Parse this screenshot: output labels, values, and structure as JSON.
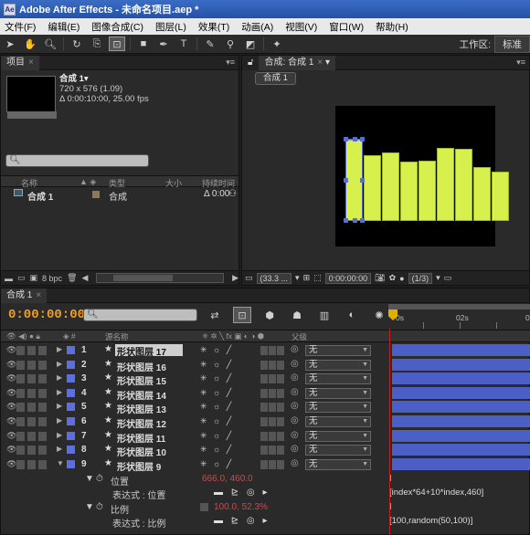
{
  "window": {
    "title": "Adobe After Effects - 未命名项目.aep *",
    "icon": "ae-app-icon"
  },
  "menu": [
    "文件(F)",
    "编辑(E)",
    "图像合成(C)",
    "图层(L)",
    "效果(T)",
    "动画(A)",
    "视图(V)",
    "窗口(W)",
    "帮助(H)"
  ],
  "toolbar": {
    "tools": [
      "selection-icon",
      "hand-icon",
      "zoom-icon",
      "rotate-icon",
      "camera-icon",
      "pan-behind-icon",
      "rectangle-icon",
      "pen-icon",
      "text-icon",
      "brush-icon",
      "clone-stamp-icon",
      "eraser-icon",
      "puppet-pin-icon"
    ],
    "workspace_label": "工作区:",
    "workspace_value": "标准"
  },
  "project": {
    "tab": "项目",
    "comp_name": "合成 1▾",
    "comp_size": "720 x 576 (1.09)",
    "comp_duration": "Δ 0:00:10:00, 25.00 fps",
    "columns": {
      "name": "名称",
      "type": "类型",
      "size": "大小",
      "duration": "持续时间"
    },
    "item": {
      "name": "合成 1",
      "type": "合成",
      "duration": "Δ 0:00"
    },
    "bpc": "8 bpc"
  },
  "viewer": {
    "tab": "合成: 合成 1",
    "subtab": "合成 1",
    "zoom": "(33.3 ...",
    "timecode": "0:00:00:00",
    "resolution": "(1/3)",
    "bar_color": "#d7f04b",
    "bar_heights": [
      0.58,
      0.47,
      0.49,
      0.42,
      0.43,
      0.52,
      0.51,
      0.38,
      0.35
    ]
  },
  "timeline": {
    "tab": "合成 1",
    "timecode": "0:00:00:00",
    "search_placeholder": "",
    "ruler_labels": [
      "0s",
      "02s",
      "0"
    ],
    "col_headers": {
      "source": "源名称",
      "parent": "父级"
    },
    "layers": [
      {
        "num": "1",
        "name": "形状图层 17",
        "parent": "无"
      },
      {
        "num": "2",
        "name": "形状图层 16",
        "parent": "无"
      },
      {
        "num": "3",
        "name": "形状图层 15",
        "parent": "无"
      },
      {
        "num": "4",
        "name": "形状图层 14",
        "parent": "无"
      },
      {
        "num": "5",
        "name": "形状图层 13",
        "parent": "无"
      },
      {
        "num": "6",
        "name": "形状图层 12",
        "parent": "无"
      },
      {
        "num": "7",
        "name": "形状图层 11",
        "parent": "无"
      },
      {
        "num": "8",
        "name": "形状图层 10",
        "parent": "无"
      },
      {
        "num": "9",
        "name": "形状图层 9",
        "parent": "无"
      }
    ],
    "properties": {
      "position_label": "位置",
      "position_value": "666.0, 460.0",
      "position_expr_label": "表达式 : 位置",
      "position_expr": "[index*64+10*index,460]",
      "scale_label": "比例",
      "scale_value": "100.0, 52.3%",
      "scale_expr_label": "表达式 : 比例",
      "scale_expr": "[100,random(50,100)]"
    }
  }
}
